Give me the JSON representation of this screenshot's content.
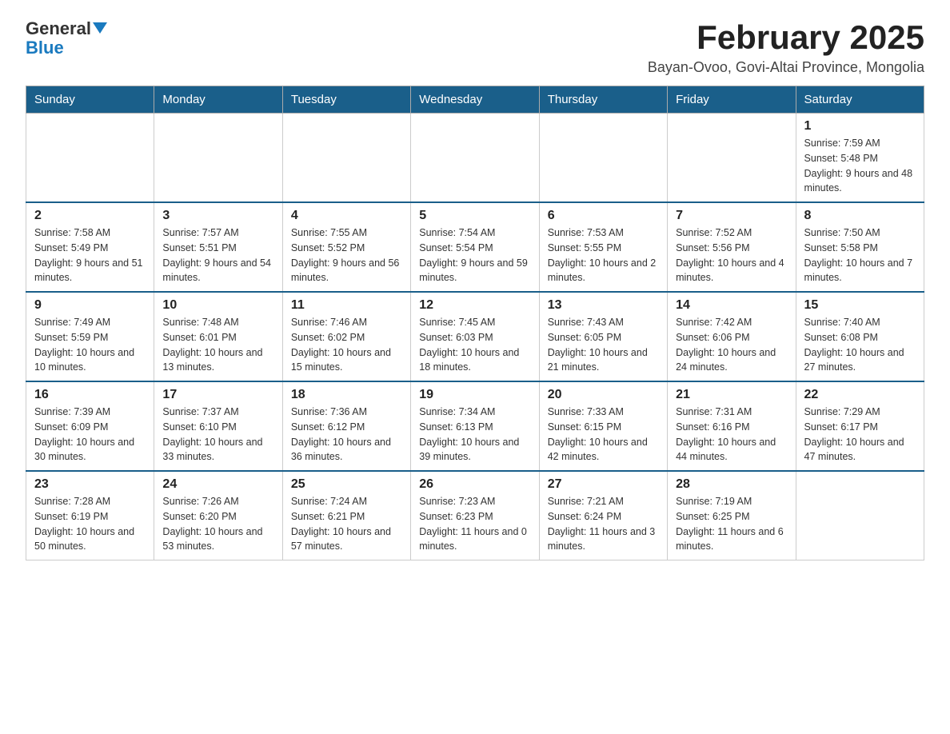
{
  "logo": {
    "text_general": "General",
    "text_blue": "Blue"
  },
  "title": "February 2025",
  "subtitle": "Bayan-Ovoo, Govi-Altai Province, Mongolia",
  "days_of_week": [
    "Sunday",
    "Monday",
    "Tuesday",
    "Wednesday",
    "Thursday",
    "Friday",
    "Saturday"
  ],
  "weeks": [
    [
      {
        "day": "",
        "sunrise": "",
        "sunset": "",
        "daylight": ""
      },
      {
        "day": "",
        "sunrise": "",
        "sunset": "",
        "daylight": ""
      },
      {
        "day": "",
        "sunrise": "",
        "sunset": "",
        "daylight": ""
      },
      {
        "day": "",
        "sunrise": "",
        "sunset": "",
        "daylight": ""
      },
      {
        "day": "",
        "sunrise": "",
        "sunset": "",
        "daylight": ""
      },
      {
        "day": "",
        "sunrise": "",
        "sunset": "",
        "daylight": ""
      },
      {
        "day": "1",
        "sunrise": "Sunrise: 7:59 AM",
        "sunset": "Sunset: 5:48 PM",
        "daylight": "Daylight: 9 hours and 48 minutes."
      }
    ],
    [
      {
        "day": "2",
        "sunrise": "Sunrise: 7:58 AM",
        "sunset": "Sunset: 5:49 PM",
        "daylight": "Daylight: 9 hours and 51 minutes."
      },
      {
        "day": "3",
        "sunrise": "Sunrise: 7:57 AM",
        "sunset": "Sunset: 5:51 PM",
        "daylight": "Daylight: 9 hours and 54 minutes."
      },
      {
        "day": "4",
        "sunrise": "Sunrise: 7:55 AM",
        "sunset": "Sunset: 5:52 PM",
        "daylight": "Daylight: 9 hours and 56 minutes."
      },
      {
        "day": "5",
        "sunrise": "Sunrise: 7:54 AM",
        "sunset": "Sunset: 5:54 PM",
        "daylight": "Daylight: 9 hours and 59 minutes."
      },
      {
        "day": "6",
        "sunrise": "Sunrise: 7:53 AM",
        "sunset": "Sunset: 5:55 PM",
        "daylight": "Daylight: 10 hours and 2 minutes."
      },
      {
        "day": "7",
        "sunrise": "Sunrise: 7:52 AM",
        "sunset": "Sunset: 5:56 PM",
        "daylight": "Daylight: 10 hours and 4 minutes."
      },
      {
        "day": "8",
        "sunrise": "Sunrise: 7:50 AM",
        "sunset": "Sunset: 5:58 PM",
        "daylight": "Daylight: 10 hours and 7 minutes."
      }
    ],
    [
      {
        "day": "9",
        "sunrise": "Sunrise: 7:49 AM",
        "sunset": "Sunset: 5:59 PM",
        "daylight": "Daylight: 10 hours and 10 minutes."
      },
      {
        "day": "10",
        "sunrise": "Sunrise: 7:48 AM",
        "sunset": "Sunset: 6:01 PM",
        "daylight": "Daylight: 10 hours and 13 minutes."
      },
      {
        "day": "11",
        "sunrise": "Sunrise: 7:46 AM",
        "sunset": "Sunset: 6:02 PM",
        "daylight": "Daylight: 10 hours and 15 minutes."
      },
      {
        "day": "12",
        "sunrise": "Sunrise: 7:45 AM",
        "sunset": "Sunset: 6:03 PM",
        "daylight": "Daylight: 10 hours and 18 minutes."
      },
      {
        "day": "13",
        "sunrise": "Sunrise: 7:43 AM",
        "sunset": "Sunset: 6:05 PM",
        "daylight": "Daylight: 10 hours and 21 minutes."
      },
      {
        "day": "14",
        "sunrise": "Sunrise: 7:42 AM",
        "sunset": "Sunset: 6:06 PM",
        "daylight": "Daylight: 10 hours and 24 minutes."
      },
      {
        "day": "15",
        "sunrise": "Sunrise: 7:40 AM",
        "sunset": "Sunset: 6:08 PM",
        "daylight": "Daylight: 10 hours and 27 minutes."
      }
    ],
    [
      {
        "day": "16",
        "sunrise": "Sunrise: 7:39 AM",
        "sunset": "Sunset: 6:09 PM",
        "daylight": "Daylight: 10 hours and 30 minutes."
      },
      {
        "day": "17",
        "sunrise": "Sunrise: 7:37 AM",
        "sunset": "Sunset: 6:10 PM",
        "daylight": "Daylight: 10 hours and 33 minutes."
      },
      {
        "day": "18",
        "sunrise": "Sunrise: 7:36 AM",
        "sunset": "Sunset: 6:12 PM",
        "daylight": "Daylight: 10 hours and 36 minutes."
      },
      {
        "day": "19",
        "sunrise": "Sunrise: 7:34 AM",
        "sunset": "Sunset: 6:13 PM",
        "daylight": "Daylight: 10 hours and 39 minutes."
      },
      {
        "day": "20",
        "sunrise": "Sunrise: 7:33 AM",
        "sunset": "Sunset: 6:15 PM",
        "daylight": "Daylight: 10 hours and 42 minutes."
      },
      {
        "day": "21",
        "sunrise": "Sunrise: 7:31 AM",
        "sunset": "Sunset: 6:16 PM",
        "daylight": "Daylight: 10 hours and 44 minutes."
      },
      {
        "day": "22",
        "sunrise": "Sunrise: 7:29 AM",
        "sunset": "Sunset: 6:17 PM",
        "daylight": "Daylight: 10 hours and 47 minutes."
      }
    ],
    [
      {
        "day": "23",
        "sunrise": "Sunrise: 7:28 AM",
        "sunset": "Sunset: 6:19 PM",
        "daylight": "Daylight: 10 hours and 50 minutes."
      },
      {
        "day": "24",
        "sunrise": "Sunrise: 7:26 AM",
        "sunset": "Sunset: 6:20 PM",
        "daylight": "Daylight: 10 hours and 53 minutes."
      },
      {
        "day": "25",
        "sunrise": "Sunrise: 7:24 AM",
        "sunset": "Sunset: 6:21 PM",
        "daylight": "Daylight: 10 hours and 57 minutes."
      },
      {
        "day": "26",
        "sunrise": "Sunrise: 7:23 AM",
        "sunset": "Sunset: 6:23 PM",
        "daylight": "Daylight: 11 hours and 0 minutes."
      },
      {
        "day": "27",
        "sunrise": "Sunrise: 7:21 AM",
        "sunset": "Sunset: 6:24 PM",
        "daylight": "Daylight: 11 hours and 3 minutes."
      },
      {
        "day": "28",
        "sunrise": "Sunrise: 7:19 AM",
        "sunset": "Sunset: 6:25 PM",
        "daylight": "Daylight: 11 hours and 6 minutes."
      },
      {
        "day": "",
        "sunrise": "",
        "sunset": "",
        "daylight": ""
      }
    ]
  ]
}
